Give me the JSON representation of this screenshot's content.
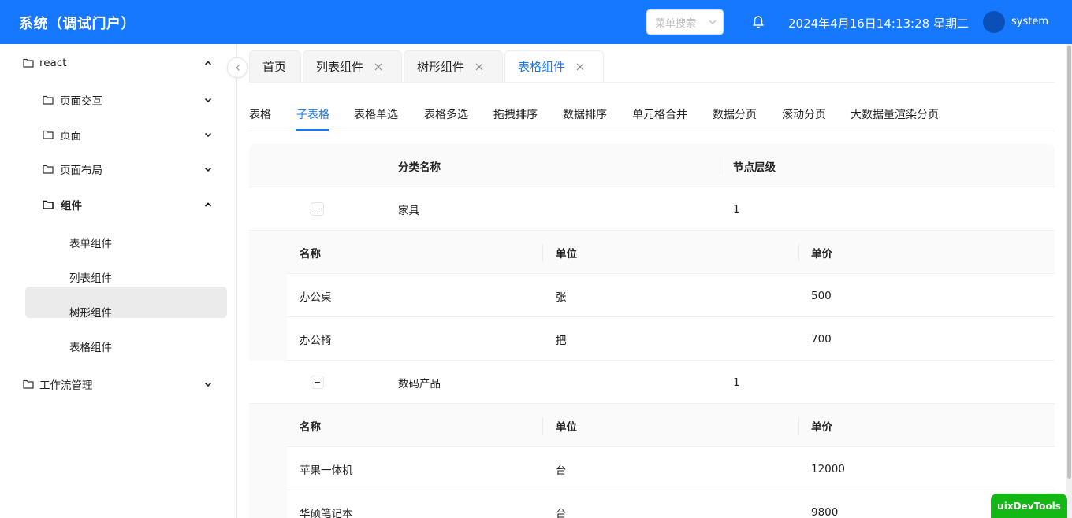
{
  "header": {
    "title": "系统（调试门户）",
    "menu_search_placeholder": "菜单搜索",
    "datetime": "2024年4月16日14:13:28 星期二",
    "username": "system",
    "brand_color": "#1677ff"
  },
  "sidebar": {
    "items": [
      {
        "label": "react",
        "icon": "folder-icon",
        "expanded": true
      },
      {
        "label": "页面交互",
        "icon": "folder-icon",
        "expanded": false
      },
      {
        "label": "页面",
        "icon": "folder-icon",
        "expanded": false
      },
      {
        "label": "页面布局",
        "icon": "folder-icon",
        "expanded": false
      },
      {
        "label": "组件",
        "icon": "folder-icon",
        "expanded": true
      },
      {
        "label": "表单组件"
      },
      {
        "label": "列表组件"
      },
      {
        "label": "树形组件"
      },
      {
        "label": "表格组件",
        "active": true
      },
      {
        "label": "工作流管理",
        "icon": "folder-icon",
        "expanded": false
      }
    ]
  },
  "tabs": [
    {
      "label": "首页",
      "closable": false
    },
    {
      "label": "列表组件",
      "closable": true
    },
    {
      "label": "树形组件",
      "closable": true
    },
    {
      "label": "表格组件",
      "closable": true,
      "active": true
    }
  ],
  "subtabs": [
    {
      "label": "表格"
    },
    {
      "label": "子表格",
      "active": true
    },
    {
      "label": "表格单选"
    },
    {
      "label": "表格多选"
    },
    {
      "label": "拖拽排序"
    },
    {
      "label": "数据排序"
    },
    {
      "label": "单元格合并"
    },
    {
      "label": "数据分页"
    },
    {
      "label": "滚动分页"
    },
    {
      "label": "大数据量渲染分页"
    }
  ],
  "table": {
    "columns": [
      "分类名称",
      "节点层级"
    ],
    "sub_columns": [
      "名称",
      "单位",
      "单价"
    ],
    "groups": [
      {
        "name": "家具",
        "level": "1",
        "items": [
          {
            "name": "办公桌",
            "unit": "张",
            "price": "500"
          },
          {
            "name": "办公椅",
            "unit": "把",
            "price": "700"
          }
        ]
      },
      {
        "name": "数码产品",
        "level": "1",
        "items": [
          {
            "name": "苹果一体机",
            "unit": "台",
            "price": "12000"
          },
          {
            "name": "华硕笔记本",
            "unit": "台",
            "price": "9800"
          }
        ]
      }
    ]
  },
  "devtools_label": "uixDevTools"
}
